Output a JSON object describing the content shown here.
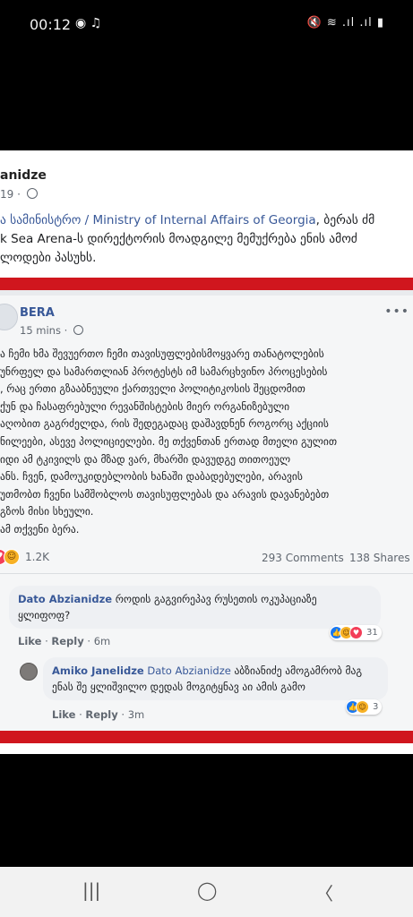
{
  "status_bar": {
    "time": "00:12",
    "left_icons": "◉ ♫",
    "right_icons": "🔇 ≋ .ıl .ıl ▮"
  },
  "post": {
    "author": "anidze",
    "time": "19 ·",
    "text_lines": [
      [
        "ა სამინისტრო / Ministry of Internal Affairs of Georgia",
        ", ბერას ძმ"
      ],
      [
        "k Sea Arena-ს დირექტორის მოადგილე მემუქრება ენის ამოძ"
      ],
      [
        "ლოდები პასუხს."
      ]
    ]
  },
  "shared": {
    "page_name": "BERA",
    "time": "15 mins ·",
    "more": "•••",
    "body_lines": [
      "ა ჩემი ხმა შევუერთო ჩემი თავისუფლებისმოყვარე თანატოლების",
      "უნრფელ და სამართლიან პროტესტს იმ სამარცხვინო პროცესების",
      ", რაც ერთი გზააბნეული ქართველი პოლიტიკოსის შეცდომით",
      "ქუნ და ჩასაფრებული რევანშისტების მიერ ორგანიზებული",
      "აღობით გაგრძელდა, რის შედეგადაც დაშავდნენ როგორც აქციის",
      "ნილეები, ასევე პოლიციელები. მე თქვენთან ერთად მთელი გულით",
      "იდი ამ ტკივილს და მზად ვარ, მხარში დავუდგე თითოეულ",
      "ანს. ჩვენ, დამოუკიდებლობის ხანაში დაბადებულები, არავის",
      "უთმობთ ჩვენი სამშობლოს თავისუფლებას და არავის დავანებებთ",
      "გზოს მისი სხეული.",
      "ამ თქვენი ბერა."
    ],
    "reactions_count": "1.2K",
    "comments": "293 Comments",
    "shares": "138 Shares"
  },
  "comment1": {
    "author": "Dato Abzianidze",
    "text_line1": " როდის გაგვირეპავ რუსეთის ოკუპაციაზე",
    "text_line2": "ყლიფოფ?",
    "like": "Like",
    "reply": "Reply",
    "time": "6m",
    "react_count": "31"
  },
  "reply1": {
    "author": "Amiko Janelidze",
    "mention": "Dato Abzianidze",
    "text_line1": " აბზიანიძე ამოგამრობ მაგ",
    "text_line2": "ენას შე ყლიშვილო დედას მოგიტყნავ აი ამის გამო",
    "like": "Like",
    "reply": "Reply",
    "time": "3m",
    "react_count": "3"
  },
  "nav": {
    "recents": "|||",
    "home": "◯",
    "back": "〈"
  },
  "colors": {
    "red_band": "#d0161e",
    "link_blue": "#385898",
    "love": "#f33e58",
    "haha": "#f7b125",
    "like": "#1877f2"
  }
}
